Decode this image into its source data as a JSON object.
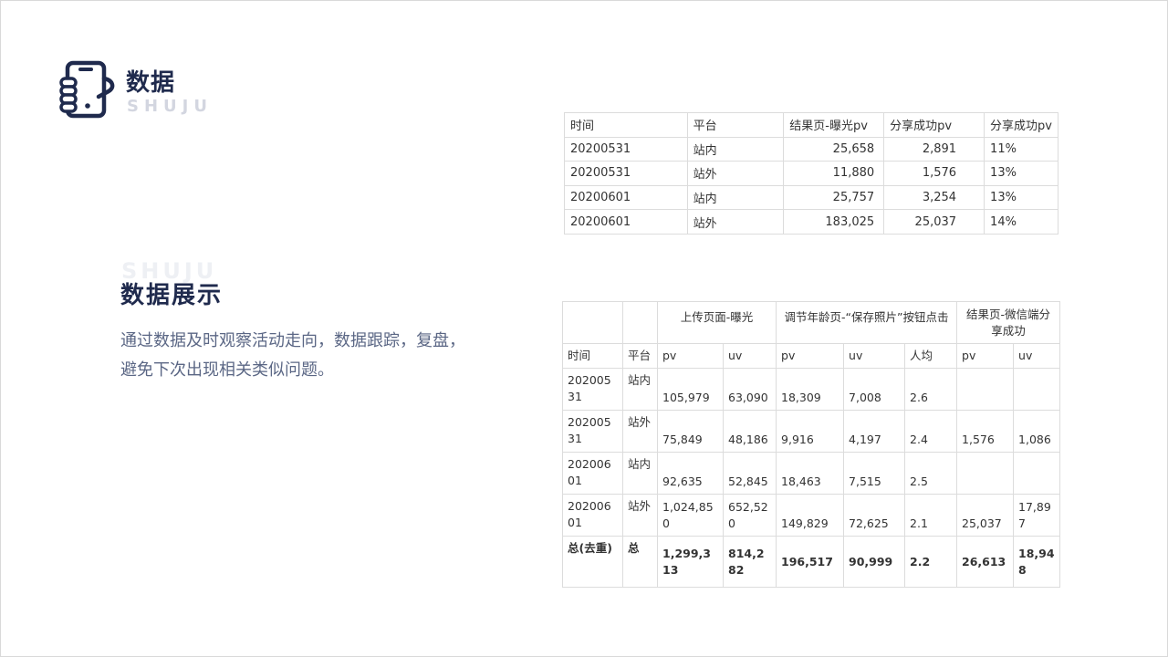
{
  "logo": {
    "title": "数据",
    "subtitle": "SHUJU",
    "icon": "phone-in-hand-icon"
  },
  "section": {
    "watermark": "SHUJU",
    "title": "数据展示",
    "description": "通过数据及时观察活动走向，数据跟踪，复盘，避免下次出现相关类似问题。"
  },
  "table1": {
    "headers": [
      "时间",
      "平台",
      "结果页-曝光pv",
      "分享成功pv",
      "分享成功pv"
    ],
    "rows": [
      [
        "20200531",
        "站内",
        "25,658",
        "2,891",
        "11%"
      ],
      [
        "20200531",
        "站外",
        "11,880",
        "1,576",
        "13%"
      ],
      [
        "20200601",
        "站内",
        "25,757",
        "3,254",
        "13%"
      ],
      [
        "20200601",
        "站外",
        "183,025",
        "25,037",
        "14%"
      ]
    ]
  },
  "table2": {
    "group_headers": [
      "上传页面-曝光",
      "调节年龄页-“保存照片”按钮点击",
      "结果页-微信端分享成功"
    ],
    "sub_headers": [
      "时间",
      "平台",
      "pv",
      "uv",
      "pv",
      "uv",
      "人均",
      "pv",
      "uv"
    ],
    "rows": [
      [
        "20200531",
        "站内",
        "105,979",
        "63,090",
        "18,309",
        "7,008",
        "2.6",
        "",
        ""
      ],
      [
        "20200531",
        "站外",
        "75,849",
        "48,186",
        "9,916",
        "4,197",
        "2.4",
        "1,576",
        "1,086"
      ],
      [
        "20200601",
        "站内",
        "92,635",
        "52,845",
        "18,463",
        "7,515",
        "2.5",
        "",
        ""
      ],
      [
        "20200601",
        "站外",
        "1,024,850",
        "652,520",
        "149,829",
        "72,625",
        "2.1",
        "25,037",
        "17,897"
      ]
    ],
    "total": [
      "总(去重)",
      "总",
      "1,299,313",
      "814,282",
      "196,517",
      "90,999",
      "2.2",
      "26,613",
      "18,948"
    ]
  },
  "colors": {
    "navy": "#1f2a4d",
    "muted_text": "#5b6785",
    "watermark": "#d3d6e0",
    "border": "#dcdcdc"
  }
}
